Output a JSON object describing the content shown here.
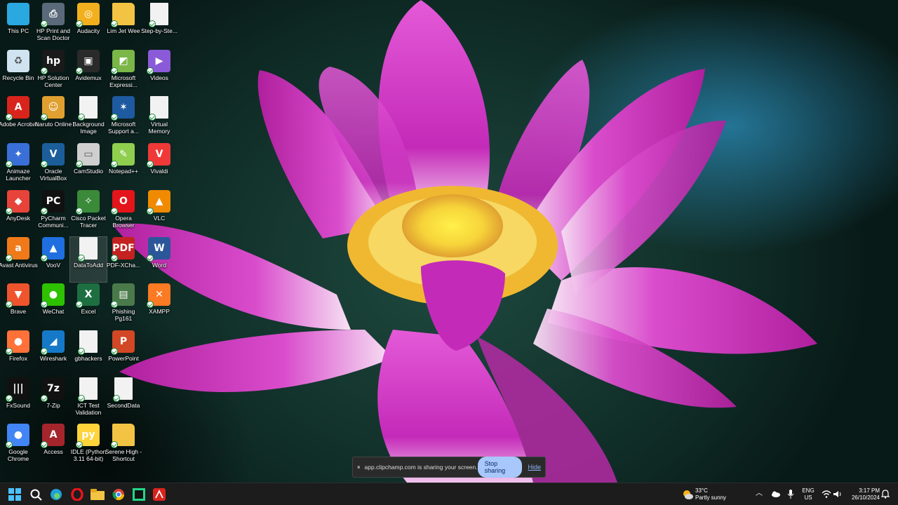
{
  "desktop": {
    "icons": [
      {
        "label": "This PC",
        "icon": "monitor-icon",
        "color": "#2aa8e0",
        "glyph": ""
      },
      {
        "label": "Recycle Bin",
        "icon": "recycle-bin-icon",
        "color": "#cfe3f0",
        "glyph": "♻"
      },
      {
        "label": "Adobe Acrobat",
        "icon": "adobe-acrobat-icon",
        "color": "#d9241c",
        "glyph": "A"
      },
      {
        "label": "Animaze Launcher",
        "icon": "animaze-icon",
        "color": "#3a6fd8",
        "glyph": "✦"
      },
      {
        "label": "AnyDesk",
        "icon": "anydesk-icon",
        "color": "#e8433a",
        "glyph": "◆"
      },
      {
        "label": "Avast Antivirus",
        "icon": "avast-icon",
        "color": "#f07a1a",
        "glyph": "a"
      },
      {
        "label": "Brave",
        "icon": "brave-icon",
        "color": "#f0542d",
        "glyph": "▼"
      },
      {
        "label": "Firefox",
        "icon": "firefox-icon",
        "color": "#ff7139",
        "glyph": "●"
      },
      {
        "label": "FxSound",
        "icon": "fxsound-icon",
        "color": "#111111",
        "glyph": "|||"
      },
      {
        "label": "Google Chrome",
        "icon": "chrome-icon",
        "color": "#4285f4",
        "glyph": "●"
      },
      {
        "label": "HP Print and Scan Doctor",
        "icon": "hp-scan-doctor-icon",
        "color": "#5a6a7a",
        "glyph": "⎙"
      },
      {
        "label": "HP Solution Center",
        "icon": "hp-solution-center-icon",
        "color": "#1a1a1a",
        "glyph": "hp"
      },
      {
        "label": "Naruto Online",
        "icon": "naruto-online-icon",
        "color": "#e0a030",
        "glyph": "☺"
      },
      {
        "label": "Oracle VirtualBox",
        "icon": "virtualbox-icon",
        "color": "#1b5e9a",
        "glyph": "V"
      },
      {
        "label": "PyCharm Communi...",
        "icon": "pycharm-icon",
        "color": "#111111",
        "glyph": "PC"
      },
      {
        "label": "VooV",
        "icon": "voov-icon",
        "color": "#1f6fe0",
        "glyph": "▲"
      },
      {
        "label": "WeChat",
        "icon": "wechat-icon",
        "color": "#2dc100",
        "glyph": "●"
      },
      {
        "label": "Wireshark",
        "icon": "wireshark-icon",
        "color": "#1679c8",
        "glyph": "◢"
      },
      {
        "label": "7-Zip",
        "icon": "7zip-icon",
        "color": "#111111",
        "glyph": "7z"
      },
      {
        "label": "Access",
        "icon": "access-icon",
        "color": "#a4262c",
        "glyph": "A"
      },
      {
        "label": "Audacity",
        "icon": "audacity-icon",
        "color": "#f2b01e",
        "glyph": "◎"
      },
      {
        "label": "Avidemux",
        "icon": "avidemux-icon",
        "color": "#2a2a2a",
        "glyph": "▣"
      },
      {
        "label": "Background Image",
        "icon": "document-icon",
        "color": "#f2f2f2",
        "glyph": ""
      },
      {
        "label": "CamStudio",
        "icon": "camstudio-icon",
        "color": "#cfcfcf",
        "glyph": "▭"
      },
      {
        "label": "Cisco Packet Tracer",
        "icon": "cisco-packet-tracer-icon",
        "color": "#3a8a3a",
        "glyph": "✧"
      },
      {
        "label": "DataToAdd",
        "icon": "document-icon",
        "color": "#f2f2f2",
        "glyph": ""
      },
      {
        "label": "Excel",
        "icon": "excel-icon",
        "color": "#1d6f42",
        "glyph": "X"
      },
      {
        "label": "gbhackers",
        "icon": "document-icon",
        "color": "#f2f2f2",
        "glyph": ""
      },
      {
        "label": "ICT Test Validation",
        "icon": "document-icon",
        "color": "#f2f2f2",
        "glyph": ""
      },
      {
        "label": "IDLE (Python 3.11 64-bit)",
        "icon": "python-idle-icon",
        "color": "#ffd43b",
        "glyph": "py"
      },
      {
        "label": "Lim Jet Wee",
        "icon": "folder-icon",
        "color": "#f3c443",
        "glyph": ""
      },
      {
        "label": "Microsoft Expressi...",
        "icon": "ms-expression-icon",
        "color": "#7ab648",
        "glyph": "◩"
      },
      {
        "label": "Microsoft Support a...",
        "icon": "ms-support-icon",
        "color": "#1e5aa0",
        "glyph": "✶"
      },
      {
        "label": "Notepad++",
        "icon": "notepadpp-icon",
        "color": "#8fce4f",
        "glyph": "✎"
      },
      {
        "label": "Opera Browser",
        "icon": "opera-icon",
        "color": "#e4141b",
        "glyph": "O"
      },
      {
        "label": "PDF-XCha...",
        "icon": "pdf-xchange-icon",
        "color": "#c42121",
        "glyph": "PDF"
      },
      {
        "label": "Phishing Pg161",
        "icon": "phishing-doc-icon",
        "color": "#4a7a4a",
        "glyph": "▤"
      },
      {
        "label": "PowerPoint",
        "icon": "powerpoint-icon",
        "color": "#d24726",
        "glyph": "P"
      },
      {
        "label": "SecondData",
        "icon": "document-icon",
        "color": "#f2f2f2",
        "glyph": ""
      },
      {
        "label": "Serene High - Shortcut",
        "icon": "folder-icon",
        "color": "#f3c443",
        "glyph": ""
      },
      {
        "label": "Step-by-Ste...",
        "icon": "pdf-document-icon",
        "color": "#f2f2f2",
        "glyph": ""
      },
      {
        "label": "Videos",
        "icon": "videos-folder-icon",
        "color": "#8a5ad8",
        "glyph": "▶"
      },
      {
        "label": "Virtual Memory",
        "icon": "document-icon",
        "color": "#f2f2f2",
        "glyph": ""
      },
      {
        "label": "Vivaldi",
        "icon": "vivaldi-icon",
        "color": "#ef3939",
        "glyph": "V"
      },
      {
        "label": "VLC",
        "icon": "vlc-icon",
        "color": "#f08a00",
        "glyph": "▲"
      },
      {
        "label": "Word",
        "icon": "word-icon",
        "color": "#2b579a",
        "glyph": "W"
      },
      {
        "label": "XAMPP",
        "icon": "xampp-icon",
        "color": "#fb7a24",
        "glyph": "✕"
      }
    ]
  },
  "share_bar": {
    "message": "app.clipchamp.com is sharing your screen.",
    "stop_label": "Stop sharing",
    "hide_label": "Hide"
  },
  "taskbar": {
    "pinned": [
      {
        "name": "start-button",
        "icon": "windows-start-icon"
      },
      {
        "name": "search-button",
        "icon": "search-icon"
      },
      {
        "name": "edge-button",
        "icon": "edge-icon"
      },
      {
        "name": "opera-taskbar-button",
        "icon": "opera-icon"
      },
      {
        "name": "file-explorer-button",
        "icon": "file-explorer-icon"
      },
      {
        "name": "chrome-taskbar-button",
        "icon": "chrome-icon"
      },
      {
        "name": "pycharm-taskbar-button",
        "icon": "pycharm-icon"
      },
      {
        "name": "acrobat-taskbar-button",
        "icon": "adobe-acrobat-icon"
      }
    ],
    "weather": {
      "temp": "33°C",
      "condition": "Partly sunny"
    },
    "language": {
      "lang": "ENG",
      "region": "US"
    },
    "clock": {
      "time": "3:17 PM",
      "date": "26/10/2024"
    }
  }
}
